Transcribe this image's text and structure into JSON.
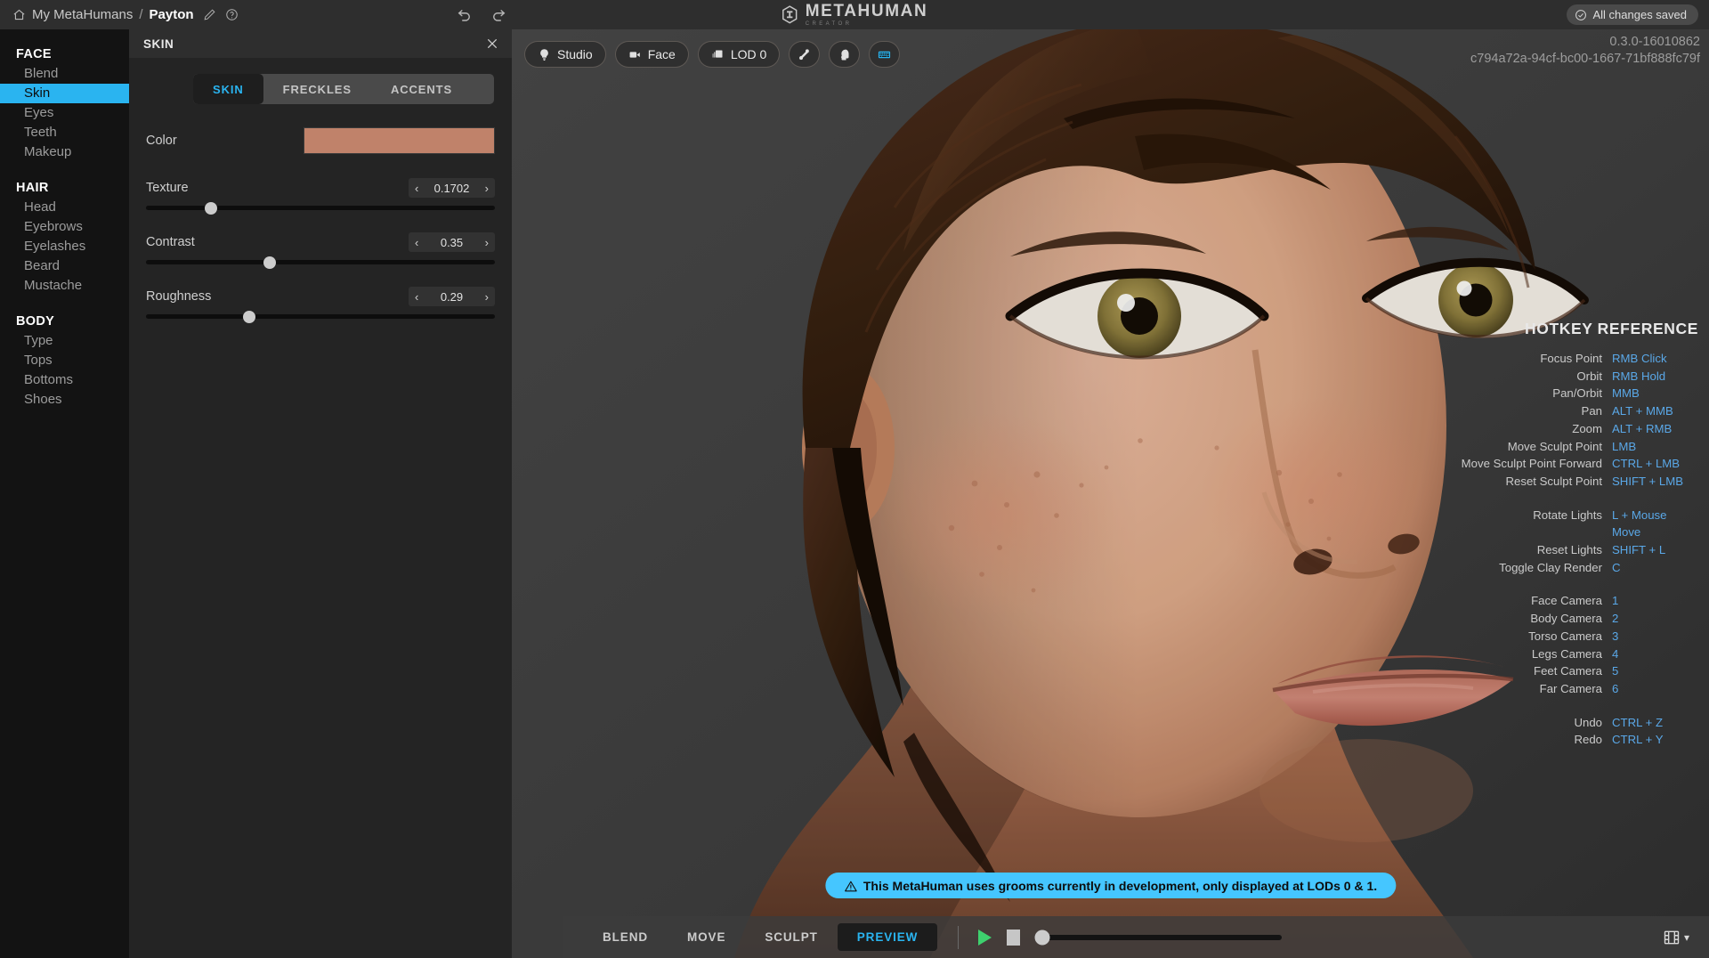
{
  "topbar": {
    "home_icon": "home-icon",
    "breadcrumb_parent": "My MetaHumans",
    "breadcrumb_separator": "/",
    "breadcrumb_current": "Payton",
    "edit_icon": "pencil-icon",
    "help_icon": "question-circle-icon",
    "undo_icon": "undo-arrow-icon",
    "redo_icon": "redo-arrow-icon",
    "logo_title": "METAHUMAN",
    "logo_subtitle": "CREATOR",
    "saved_label": "All changes saved",
    "saved_icon": "check-circle-icon"
  },
  "sidebar": {
    "groups": [
      {
        "title": "FACE",
        "items": [
          {
            "label": "Blend",
            "active": false
          },
          {
            "label": "Skin",
            "active": true
          },
          {
            "label": "Eyes",
            "active": false
          },
          {
            "label": "Teeth",
            "active": false
          },
          {
            "label": "Makeup",
            "active": false
          }
        ]
      },
      {
        "title": "HAIR",
        "items": [
          {
            "label": "Head",
            "active": false
          },
          {
            "label": "Eyebrows",
            "active": false
          },
          {
            "label": "Eyelashes",
            "active": false
          },
          {
            "label": "Beard",
            "active": false
          },
          {
            "label": "Mustache",
            "active": false
          }
        ]
      },
      {
        "title": "BODY",
        "items": [
          {
            "label": "Type",
            "active": false
          },
          {
            "label": "Tops",
            "active": false
          },
          {
            "label": "Bottoms",
            "active": false
          },
          {
            "label": "Shoes",
            "active": false
          }
        ]
      }
    ]
  },
  "panel": {
    "title": "SKIN",
    "close_icon": "close-icon",
    "tabs": [
      {
        "label": "SKIN",
        "active": true
      },
      {
        "label": "FRECKLES",
        "active": false
      },
      {
        "label": "ACCENTS",
        "active": false
      }
    ],
    "color": {
      "label": "Color",
      "value": "#c0826a"
    },
    "sliders": [
      {
        "label": "Texture",
        "value": "0.1702",
        "percent": 18.5,
        "prev_icon": "chevron-left-icon",
        "next_icon": "chevron-right-icon"
      },
      {
        "label": "Contrast",
        "value": "0.35",
        "percent": 35.5,
        "prev_icon": "chevron-left-icon",
        "next_icon": "chevron-right-icon"
      },
      {
        "label": "Roughness",
        "value": "0.29",
        "percent": 29.5,
        "prev_icon": "chevron-left-icon",
        "next_icon": "chevron-right-icon"
      }
    ]
  },
  "viewport": {
    "toolbar": [
      {
        "label": "Studio",
        "icon": "lightbulb-icon",
        "has_label": true
      },
      {
        "label": "Face",
        "icon": "camera-icon",
        "has_label": true
      },
      {
        "label": "LOD 0",
        "icon": "layers-icon",
        "has_label": true
      },
      {
        "label": "",
        "icon": "bone-icon",
        "has_label": false
      },
      {
        "label": "",
        "icon": "head-icon",
        "has_label": false
      },
      {
        "label": "",
        "icon": "keyboard-icon",
        "has_label": false
      }
    ],
    "version": "0.3.0-16010862",
    "asset_id": "c794a72a-94cf-bc00-1667-71bf888fc79f",
    "warning": {
      "icon": "warning-triangle-icon",
      "text": "This MetaHuman uses grooms currently in development, only displayed at LODs 0 & 1."
    }
  },
  "hotkeys": {
    "title": "HOTKEY REFERENCE",
    "groups": [
      [
        {
          "key": "Focus Point",
          "value": "RMB Click"
        },
        {
          "key": "Orbit",
          "value": "RMB Hold"
        },
        {
          "key": "Pan/Orbit",
          "value": "MMB"
        },
        {
          "key": "Pan",
          "value": "ALT + MMB"
        },
        {
          "key": "Zoom",
          "value": "ALT + RMB"
        },
        {
          "key": "Move Sculpt Point",
          "value": "LMB"
        },
        {
          "key": "Move Sculpt Point Forward",
          "value": "CTRL + LMB"
        },
        {
          "key": "Reset Sculpt Point",
          "value": "SHIFT + LMB"
        }
      ],
      [
        {
          "key": "Rotate Lights",
          "value": "L + Mouse Move"
        },
        {
          "key": "Reset Lights",
          "value": "SHIFT + L"
        },
        {
          "key": "Toggle Clay Render",
          "value": "C"
        }
      ],
      [
        {
          "key": "Face Camera",
          "value": "1"
        },
        {
          "key": "Body Camera",
          "value": "2"
        },
        {
          "key": "Torso Camera",
          "value": "3"
        },
        {
          "key": "Legs Camera",
          "value": "4"
        },
        {
          "key": "Feet Camera",
          "value": "5"
        },
        {
          "key": "Far Camera",
          "value": "6"
        }
      ],
      [
        {
          "key": "Undo",
          "value": "CTRL + Z"
        },
        {
          "key": "Redo",
          "value": "CTRL + Y"
        }
      ]
    ]
  },
  "bottombar": {
    "modes": [
      {
        "label": "BLEND",
        "active": false
      },
      {
        "label": "MOVE",
        "active": false
      },
      {
        "label": "SCULPT",
        "active": false
      },
      {
        "label": "PREVIEW",
        "active": true
      }
    ],
    "play_icon": "play-icon",
    "stop_icon": "stop-icon",
    "scrub_percent": 2,
    "film_icon": "film-strip-icon",
    "film_chevron": "chevron-down-icon"
  },
  "colors": {
    "accent_blue": "#2ab4f0",
    "hotkey_blue": "#5aa8e8",
    "banner_blue": "#45c6ff",
    "play_green": "#3ed16e",
    "skin_swatch": "#c0826a"
  }
}
